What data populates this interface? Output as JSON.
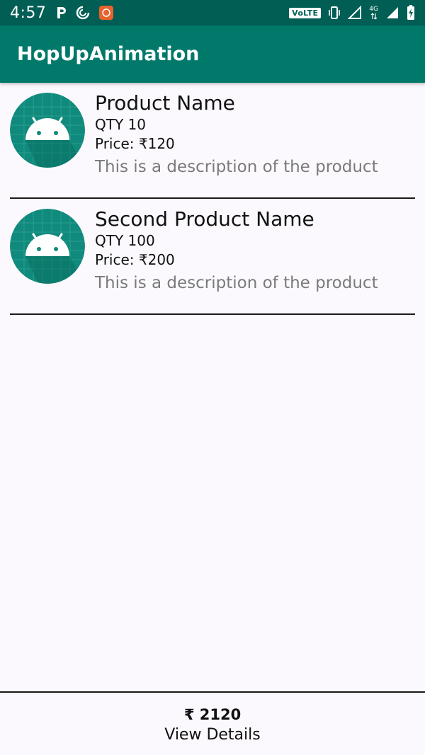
{
  "status_bar": {
    "time": "4:57",
    "left_icons": [
      "parking-app-icon",
      "sync-app-icon",
      "app-notification-icon"
    ],
    "volte": "VoLTE",
    "right_icons": [
      "vibrate-icon",
      "signal-icon",
      "data-4g-icon",
      "signal-full-icon",
      "battery-icon"
    ],
    "network": "4G"
  },
  "app_bar": {
    "title": "HopUpAnimation",
    "color": "#00796b",
    "status_color": "#005e54"
  },
  "products": [
    {
      "name": "Product Name",
      "qty": "QTY 10",
      "price": "Price: ₹120",
      "description": "This is a description of the product",
      "icon": "android-icon"
    },
    {
      "name": "Second Product Name",
      "qty": "QTY 100",
      "price": "Price: ₹200",
      "description": "This is a description of the product",
      "icon": "android-icon"
    }
  ],
  "summary": {
    "total": "₹ 2120",
    "view_details": "View Details"
  }
}
